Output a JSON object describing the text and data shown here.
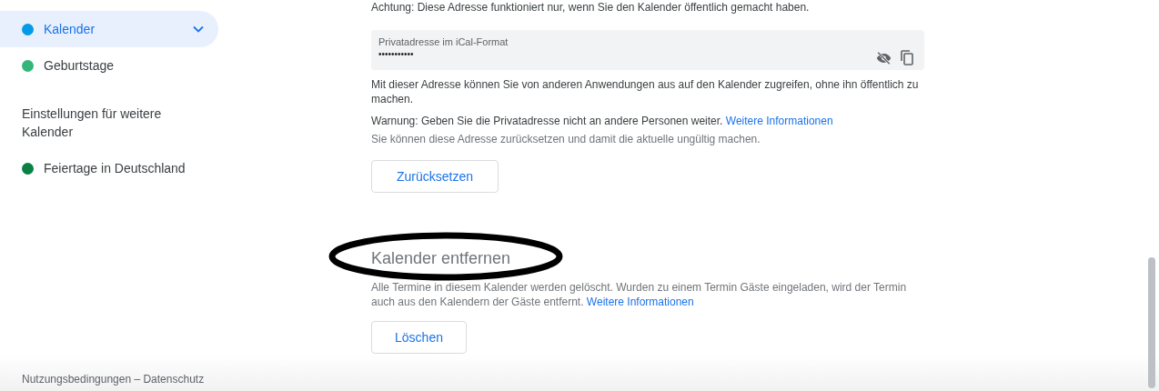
{
  "sidebar": {
    "calendars": [
      {
        "label": "Kalender",
        "color": "#039be5",
        "selected": true,
        "expanded": false
      },
      {
        "label": "Geburtstage",
        "color": "#33b679",
        "selected": false
      }
    ],
    "other_heading": "Einstellungen für weitere Kalender",
    "other_calendars": [
      {
        "label": "Feiertage in Deutschland",
        "color": "#0b8043",
        "selected": false
      }
    ],
    "footer": "Nutzungsbedingungen – Datenschutz"
  },
  "address": {
    "notice": "Achtung: Diese Adresse funktioniert nur, wenn Sie den Kalender öffentlich gemacht haben.",
    "field": {
      "label": "Privatadresse im iCal-Format",
      "value": "•••••••••••"
    },
    "info": "Mit dieser Adresse können Sie von anderen Anwendungen aus auf den Kalender zugreifen, ohne ihn öffentlich zu machen.",
    "warning": "Warnung: Geben Sie die Privatadresse nicht an andere Personen weiter.",
    "warning_link": "Weitere Informationen",
    "reset_hint": "Sie können diese Adresse zurücksetzen und damit die aktuelle ungültig machen.",
    "reset_button": "Zurücksetzen"
  },
  "remove": {
    "heading": "Kalender entfernen",
    "text": "Alle Termine in diesem Kalender werden gelöscht. Wurden zu einem Termin Gäste eingeladen, wird der Termin auch aus den Kalendern der Gäste entfernt.",
    "link": "Weitere Informationen",
    "button": "Löschen"
  }
}
